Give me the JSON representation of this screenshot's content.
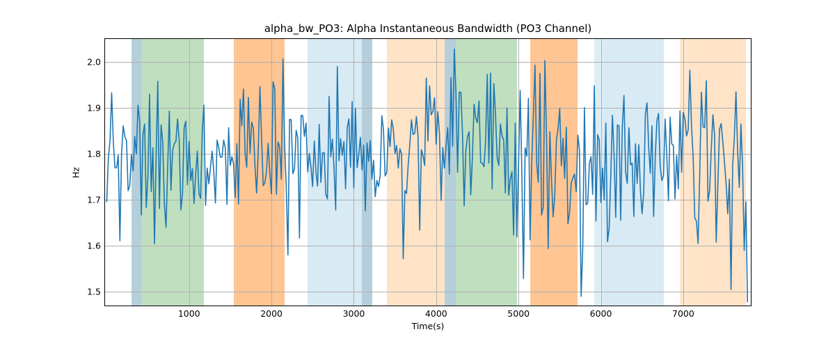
{
  "chart_data": {
    "type": "line",
    "title": "alpha_bw_PO3: Alpha Instantaneous Bandwidth (PO3 Channel)",
    "xlabel": "Time(s)",
    "ylabel": "Hz",
    "xlim": [
      -20,
      7820
    ],
    "ylim": [
      1.47,
      2.05
    ],
    "xticks": [
      1000,
      2000,
      3000,
      4000,
      5000,
      6000,
      7000
    ],
    "yticks": [
      1.5,
      1.6,
      1.7,
      1.8,
      1.9,
      2.0
    ],
    "grid": true,
    "line_color": "#1f77b4",
    "bands": [
      {
        "x0": 300,
        "x1": 420,
        "color": "#6a9fb5",
        "alpha": 0.5
      },
      {
        "x0": 420,
        "x1": 1180,
        "color": "#7fbf7f",
        "alpha": 0.5
      },
      {
        "x0": 1540,
        "x1": 2160,
        "color": "#ff7f0e",
        "alpha": 0.45
      },
      {
        "x0": 2440,
        "x1": 3100,
        "color": "#9ecae1",
        "alpha": 0.4
      },
      {
        "x0": 3100,
        "x1": 3220,
        "color": "#6a9fb5",
        "alpha": 0.5
      },
      {
        "x0": 3400,
        "x1": 4100,
        "color": "#fdd0a2",
        "alpha": 0.6
      },
      {
        "x0": 4100,
        "x1": 4240,
        "color": "#6a9fb5",
        "alpha": 0.5
      },
      {
        "x0": 4240,
        "x1": 4980,
        "color": "#7fbf7f",
        "alpha": 0.5
      },
      {
        "x0": 5140,
        "x1": 5720,
        "color": "#ff7f0e",
        "alpha": 0.45
      },
      {
        "x0": 5920,
        "x1": 6040,
        "color": "#9ecae1",
        "alpha": 0.35
      },
      {
        "x0": 6040,
        "x1": 6760,
        "color": "#9ecae1",
        "alpha": 0.4
      },
      {
        "x0": 6960,
        "x1": 7080,
        "color": "#fdd0a2",
        "alpha": 0.55
      },
      {
        "x0": 7080,
        "x1": 7760,
        "color": "#fdd0a2",
        "alpha": 0.6
      }
    ],
    "series": [
      {
        "name": "alpha_bw_PO3",
        "x_start": 0,
        "x_step": 20,
        "y": [
          1.695,
          1.792,
          1.828,
          1.933,
          1.827,
          1.77,
          1.77,
          1.797,
          1.611,
          1.8,
          1.861,
          1.837,
          1.829,
          1.72,
          1.731,
          1.798,
          1.763,
          1.838,
          1.8,
          1.906,
          1.871,
          1.667,
          1.842,
          1.865,
          1.683,
          1.75,
          1.93,
          1.718,
          1.813,
          1.605,
          1.796,
          1.958,
          1.681,
          1.863,
          1.826,
          1.692,
          1.64,
          1.77,
          1.893,
          1.721,
          1.808,
          1.822,
          1.827,
          1.876,
          1.829,
          1.678,
          1.713,
          1.857,
          1.871,
          1.733,
          1.827,
          1.742,
          1.768,
          1.692,
          1.755,
          1.806,
          1.714,
          1.703,
          1.849,
          1.906,
          1.688,
          1.769,
          1.735,
          1.772,
          1.806,
          1.761,
          1.693,
          1.83,
          1.814,
          1.793,
          1.793,
          1.83,
          1.813,
          1.69,
          1.857,
          1.775,
          1.794,
          1.778,
          1.705,
          1.822,
          1.691,
          1.919,
          1.861,
          1.941,
          1.801,
          1.771,
          1.923,
          1.801,
          1.869,
          1.856,
          1.774,
          1.715,
          1.806,
          1.946,
          1.837,
          1.731,
          1.737,
          1.762,
          1.823,
          1.759,
          1.713,
          1.957,
          1.942,
          1.712,
          1.826,
          1.815,
          1.745,
          2.007,
          1.82,
          1.726,
          1.58,
          1.875,
          1.874,
          1.757,
          1.768,
          1.851,
          1.835,
          1.617,
          1.884,
          1.883,
          1.838,
          1.867,
          1.761,
          1.801,
          1.771,
          1.729,
          1.828,
          1.761,
          1.73,
          1.864,
          1.738,
          1.802,
          1.803,
          1.712,
          1.702,
          1.925,
          1.794,
          1.832,
          1.768,
          1.678,
          1.99,
          1.785,
          1.833,
          1.797,
          1.827,
          1.724,
          1.857,
          1.876,
          1.771,
          1.914,
          1.726,
          1.899,
          1.77,
          1.798,
          1.836,
          1.765,
          1.819,
          1.676,
          1.824,
          1.784,
          1.829,
          1.745,
          1.786,
          1.707,
          1.742,
          1.729,
          1.753,
          1.883,
          1.852,
          1.752,
          1.76,
          1.856,
          1.816,
          1.874,
          1.853,
          1.801,
          1.818,
          1.769,
          1.811,
          1.8,
          1.572,
          1.72,
          1.714,
          1.775,
          1.821,
          1.874,
          1.842,
          1.845,
          1.881,
          1.838,
          1.634,
          1.809,
          1.796,
          1.775,
          1.965,
          1.828,
          1.948,
          1.885,
          1.893,
          1.922,
          1.821,
          1.892,
          1.845,
          1.699,
          1.814,
          1.769,
          1.819,
          1.857,
          1.756,
          1.966,
          1.817,
          2.028,
          1.933,
          1.76,
          1.934,
          1.934,
          1.842,
          1.687,
          1.806,
          1.837,
          1.848,
          1.711,
          1.793,
          1.908,
          1.878,
          1.868,
          1.915,
          1.781,
          1.78,
          1.772,
          1.828,
          1.973,
          1.78,
          1.976,
          1.724,
          1.953,
          1.887,
          1.792,
          1.775,
          1.865,
          1.839,
          1.83,
          1.715,
          1.9,
          1.71,
          1.745,
          1.761,
          1.624,
          1.867,
          1.619,
          1.778,
          1.938,
          1.76,
          1.529,
          1.813,
          1.795,
          1.921,
          1.613,
          1.782,
          1.883,
          1.993,
          1.779,
          1.738,
          1.975,
          1.667,
          1.684,
          2.003,
          1.834,
          1.594,
          1.848,
          1.746,
          1.663,
          1.711,
          1.831,
          1.855,
          1.899,
          1.774,
          1.834,
          1.747,
          1.858,
          1.648,
          1.673,
          1.737,
          1.748,
          1.756,
          1.718,
          1.841,
          1.808,
          1.49,
          1.598,
          1.901,
          1.689,
          1.693,
          1.779,
          1.794,
          1.712,
          1.948,
          1.654,
          1.842,
          1.83,
          1.694,
          1.769,
          1.7,
          1.867,
          1.609,
          1.637,
          1.753,
          1.884,
          1.797,
          1.662,
          1.863,
          1.861,
          1.656,
          1.859,
          1.927,
          1.761,
          1.736,
          1.857,
          1.776,
          1.78,
          1.664,
          1.822,
          1.736,
          1.82,
          1.719,
          1.67,
          1.716,
          1.887,
          1.911,
          1.815,
          1.758,
          1.861,
          1.664,
          1.794,
          1.872,
          1.888,
          1.773,
          1.742,
          1.752,
          1.876,
          1.797,
          1.698,
          1.88,
          1.822,
          1.818,
          1.702,
          1.797,
          1.724,
          1.893,
          1.76,
          1.89,
          1.876,
          1.839,
          1.852,
          1.982,
          1.862,
          1.794,
          1.66,
          1.654,
          1.605,
          1.757,
          1.934,
          1.859,
          1.857,
          1.959,
          1.697,
          1.72,
          1.81,
          1.885,
          1.841,
          1.608,
          1.735,
          1.853,
          1.866,
          1.827,
          1.783,
          1.735,
          1.67,
          1.745,
          1.505,
          1.776,
          1.835,
          1.935,
          1.807,
          1.727,
          1.865,
          1.773,
          1.59,
          1.696,
          1.477
        ]
      }
    ]
  }
}
